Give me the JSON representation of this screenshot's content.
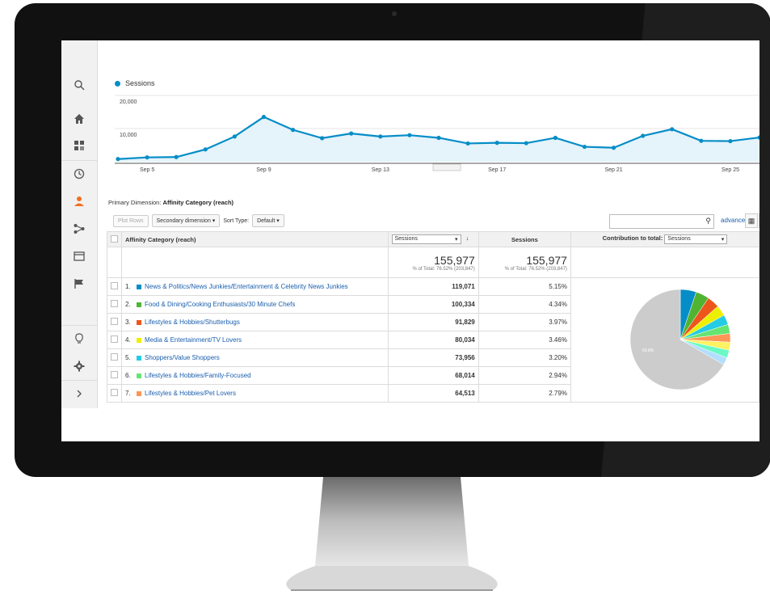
{
  "sidebar": {
    "items": [
      {
        "icon": "search-icon"
      },
      {
        "icon": "home-icon"
      },
      {
        "icon": "dashboard-icon"
      },
      {
        "icon": "clock-icon"
      },
      {
        "icon": "person-icon",
        "active": true
      },
      {
        "icon": "acquisition-icon"
      },
      {
        "icon": "behavior-icon"
      },
      {
        "icon": "flag-icon"
      },
      {
        "icon": "lightbulb-icon"
      },
      {
        "icon": "gear-icon"
      },
      {
        "icon": "chevron-right-icon"
      }
    ]
  },
  "chart": {
    "legend": "Sessions",
    "accent": "#058dc7",
    "y_ticks": [
      "20,000",
      "10,000"
    ],
    "x_ticks": [
      "Sep 5",
      "Sep 9",
      "Sep 13",
      "Sep 17",
      "Sep 21",
      "Sep 25"
    ]
  },
  "chart_data": {
    "type": "line",
    "series": [
      {
        "name": "Sessions",
        "values": [
          800,
          1300,
          1400,
          3700,
          7600,
          13500,
          9600,
          7100,
          8500,
          7600,
          8000,
          7200,
          5500,
          5700,
          5600,
          7200,
          4500,
          4200,
          7800,
          9800,
          6300,
          6200,
          7300
        ]
      }
    ],
    "x_labels_shown": [
      "Sep 5",
      "Sep 9",
      "Sep 13",
      "Sep 17",
      "Sep 21",
      "Sep 25"
    ],
    "ylim": [
      0,
      20000
    ],
    "grid": true
  },
  "primary_dimension": {
    "label": "Primary Dimension:",
    "value": "Affinity Category (reach)"
  },
  "toolbar": {
    "plot_rows": "Plot Rows",
    "secondary_dimension": "Secondary dimension",
    "sort_type_label": "Sort Type:",
    "sort_type_value": "Default",
    "advanced": "advanced"
  },
  "table": {
    "col_dimension": "Affinity Category (reach)",
    "col_sessions_select": "Sessions",
    "col_sessions": "Sessions",
    "col_contribution": "Contribution to total:",
    "col_contribution_select": "Sessions",
    "total_sessions": "155,977",
    "total_sub": "% of Total: 76.52% (203,847)",
    "total_pct": "155,977",
    "total_pct_sub": "% of Total: 76.52% (203,847)",
    "rows": [
      {
        "idx": "1.",
        "color": "#058dc7",
        "label": "News & Politics/News Junkies/Entertainment & Celebrity News Junkies",
        "sessions": "119,071",
        "pct": "5.15%"
      },
      {
        "idx": "2.",
        "color": "#50b432",
        "label": "Food & Dining/Cooking Enthusiasts/30 Minute Chefs",
        "sessions": "100,334",
        "pct": "4.34%"
      },
      {
        "idx": "3.",
        "color": "#ed561b",
        "label": "Lifestyles & Hobbies/Shutterbugs",
        "sessions": "91,829",
        "pct": "3.97%"
      },
      {
        "idx": "4.",
        "color": "#edef00",
        "label": "Media & Entertainment/TV Lovers",
        "sessions": "80,034",
        "pct": "3.46%"
      },
      {
        "idx": "5.",
        "color": "#24cbe5",
        "label": "Shoppers/Value Shoppers",
        "sessions": "73,956",
        "pct": "3.20%"
      },
      {
        "idx": "6.",
        "color": "#64e572",
        "label": "Lifestyles & Hobbies/Family-Focused",
        "sessions": "68,014",
        "pct": "2.94%"
      },
      {
        "idx": "7.",
        "color": "#ff9655",
        "label": "Lifestyles & Hobbies/Pet Lovers",
        "sessions": "64,513",
        "pct": "2.79%"
      }
    ]
  },
  "pie": {
    "other_label": "69.8%",
    "slices": [
      {
        "value": 5.15,
        "color": "#058dc7"
      },
      {
        "value": 4.34,
        "color": "#50b432"
      },
      {
        "value": 3.97,
        "color": "#ed561b"
      },
      {
        "value": 3.46,
        "color": "#edef00"
      },
      {
        "value": 3.2,
        "color": "#24cbe5"
      },
      {
        "value": 2.94,
        "color": "#64e572"
      },
      {
        "value": 2.79,
        "color": "#ff9655"
      },
      {
        "value": 2.6,
        "color": "#fff263"
      },
      {
        "value": 2.5,
        "color": "#6af9c4"
      },
      {
        "value": 2.4,
        "color": "#b2deff"
      },
      {
        "value": 66.65,
        "color": "#cccccc"
      }
    ]
  }
}
